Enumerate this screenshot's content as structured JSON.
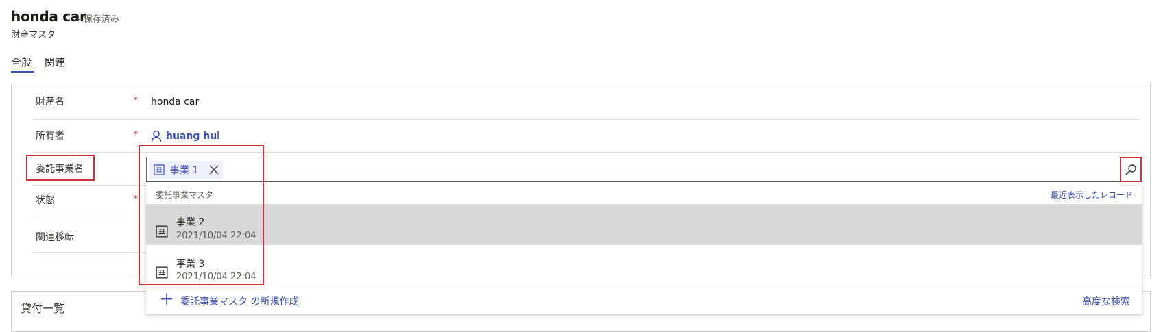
{
  "header": {
    "record_title": "honda car",
    "save_status": "- 保存済み",
    "entity_name": "財産マスタ"
  },
  "tabs": [
    {
      "label": "全般",
      "active": true
    },
    {
      "label": "関連",
      "active": false
    }
  ],
  "form": {
    "fields": [
      {
        "label": "財産名",
        "required": true,
        "value": "honda car"
      },
      {
        "label": "所有者",
        "required": true,
        "value": "huang hui",
        "icon": "person-icon"
      },
      {
        "label": "委託事業名",
        "required": false,
        "value": ""
      },
      {
        "label": "状態",
        "required": true,
        "value": ""
      },
      {
        "label": "関連移転",
        "required": false,
        "value": ""
      }
    ],
    "required_mark": "*"
  },
  "lookup": {
    "selected_chip": {
      "label": "事業 1",
      "icon": "entity-icon"
    },
    "dropdown_header": "委託事業マスタ",
    "recent_link": "最近表示したレコード",
    "items": [
      {
        "name": "事業 2",
        "date": "2021/10/04 22:04",
        "selected": true,
        "icon": "entity-icon"
      },
      {
        "name": "事業 3",
        "date": "2021/10/04 22:04",
        "selected": false,
        "icon": "entity-icon"
      }
    ],
    "new_record_link": "委託事業マスタ の新規作成",
    "advanced_search_link": "高度な検索",
    "search_icon": "search-icon",
    "close_icon": "close-icon",
    "plus_icon": "plus-icon"
  },
  "sections": [
    {
      "title": "貸付一覧"
    }
  ],
  "colors": {
    "accent": "#4051b5",
    "highlight_box": "#d13438",
    "selected_row": "#d9d9d9"
  }
}
